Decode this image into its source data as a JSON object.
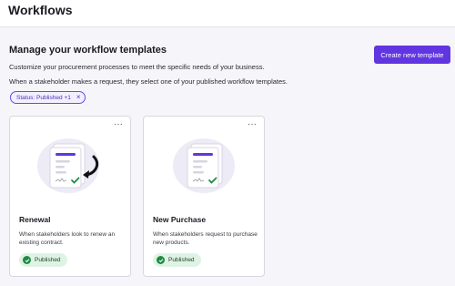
{
  "header": {
    "title": "Workflows"
  },
  "main": {
    "section_title": "Manage your workflow templates",
    "description_1": "Customize your procurement processes to meet the specific needs of your business.",
    "description_2": "When a stakeholder makes a request, they select one of your published workflow templates.",
    "filter_chip": {
      "label": "Status: Published +1",
      "close": "×"
    },
    "create_button": "Create new template",
    "cards": [
      {
        "title": "Renewal",
        "description": "When stakeholders look to renew an existing contract.",
        "status": "Published",
        "more": "···",
        "illustration": "document-with-return-arrow"
      },
      {
        "title": "New Purchase",
        "description": "When stakeholders request to purchase new products.",
        "status": "Published",
        "more": "···",
        "illustration": "stacked-documents"
      }
    ]
  },
  "colors": {
    "accent": "#6135e0",
    "published_bg": "#dff3e4",
    "published_icon": "#1f8a43"
  }
}
